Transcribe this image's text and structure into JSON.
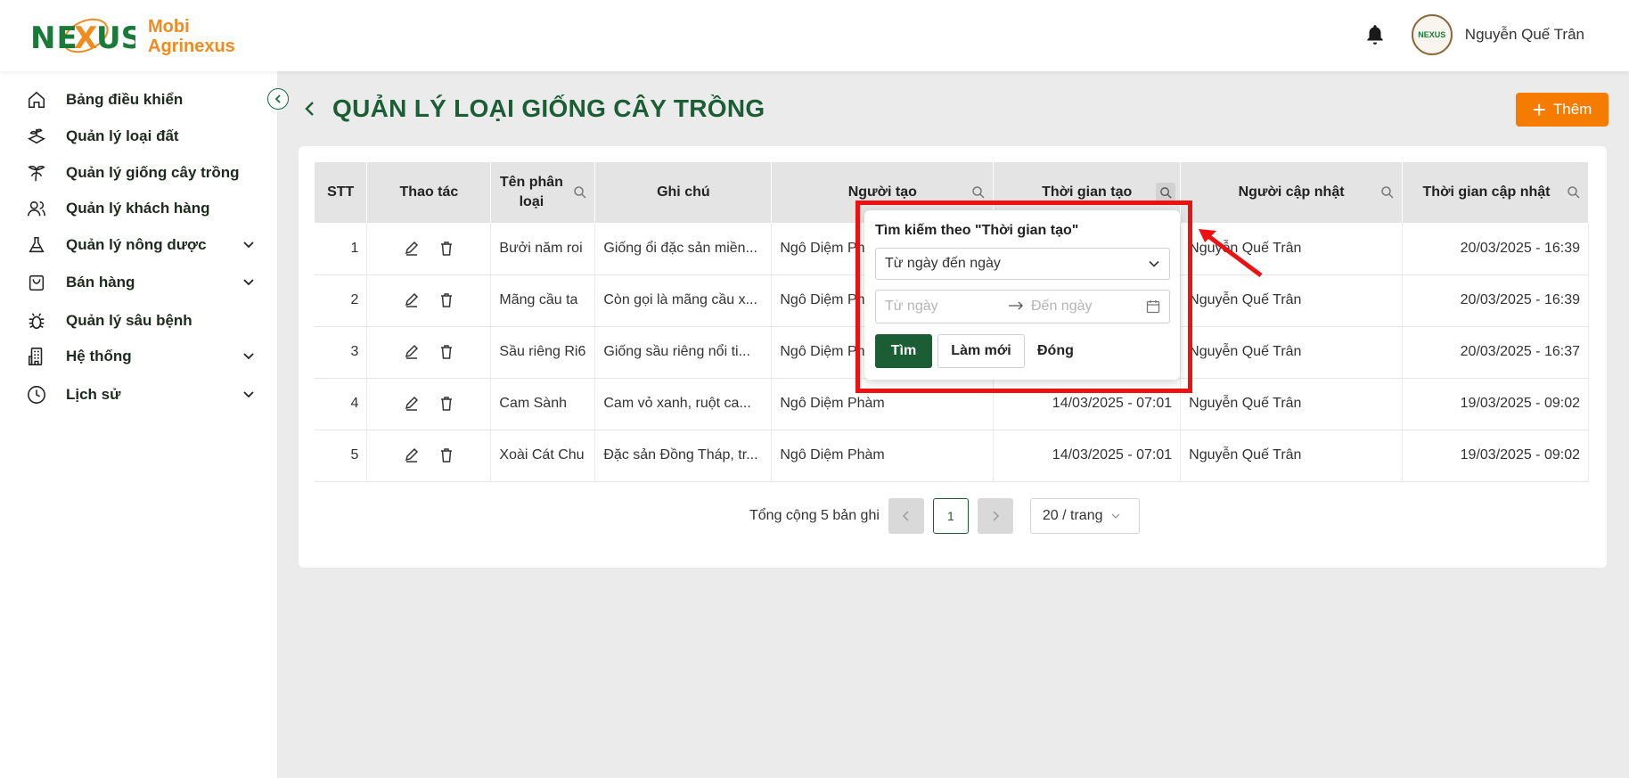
{
  "brand": {
    "line1": "Mobi",
    "line2": "Agrinexus",
    "mark": "NEXUS",
    "avatar_text": "NEXUS"
  },
  "header": {
    "user_name": "Nguyễn Quế Trân"
  },
  "sidebar": {
    "items": [
      {
        "label": "Bảng điều khiển",
        "icon": "home-icon",
        "expandable": false
      },
      {
        "label": "Quản lý loại đất",
        "icon": "soil-icon",
        "expandable": false
      },
      {
        "label": "Quản lý giống cây trồng",
        "icon": "plant-icon",
        "expandable": false
      },
      {
        "label": "Quản lý khách hàng",
        "icon": "users-icon",
        "expandable": false
      },
      {
        "label": "Quản lý nông dược",
        "icon": "flask-icon",
        "expandable": true
      },
      {
        "label": "Bán hàng",
        "icon": "shopping-bag-icon",
        "expandable": true
      },
      {
        "label": "Quản lý sâu bệnh",
        "icon": "bug-icon",
        "expandable": false
      },
      {
        "label": "Hệ thống",
        "icon": "building-icon",
        "expandable": true
      },
      {
        "label": "Lịch sử",
        "icon": "clock-icon",
        "expandable": true
      }
    ]
  },
  "page": {
    "title": "QUẢN LÝ LOẠI GIỐNG CÂY TRỒNG",
    "add_label": "Thêm"
  },
  "table": {
    "headers": {
      "stt": "STT",
      "actions": "Thao tác",
      "name": "Tên phân loại",
      "note": "Ghi chú",
      "creator": "Người tạo",
      "created_at": "Thời gian tạo",
      "updater": "Người cập nhật",
      "updated_at": "Thời gian cập nhật"
    },
    "rows": [
      {
        "stt": "1",
        "name": "Bưởi năm roi",
        "note": "Giống ổi đặc sản miền...",
        "creator": "Ngô Diệm Ph",
        "created_at": "",
        "updater": "Nguyễn Quế Trân",
        "updated_at": "20/03/2025 - 16:39"
      },
      {
        "stt": "2",
        "name": "Mãng cầu ta",
        "note": "Còn gọi là mãng cầu x...",
        "creator": "Ngô Diệm Ph",
        "created_at": "",
        "updater": "Nguyễn Quế Trân",
        "updated_at": "20/03/2025 - 16:39"
      },
      {
        "stt": "3",
        "name": "Sầu riêng Ri6",
        "note": "Giống sầu riêng nổi ti...",
        "creator": "Ngô Diệm Ph",
        "created_at": "",
        "updater": "Nguyễn Quế Trân",
        "updated_at": "20/03/2025 - 16:37"
      },
      {
        "stt": "4",
        "name": "Cam Sành",
        "note": "Cam vỏ xanh, ruột ca...",
        "creator": "Ngô Diệm Phàm",
        "created_at": "14/03/2025 - 07:01",
        "updater": "Nguyễn Quế Trân",
        "updated_at": "19/03/2025 - 09:02"
      },
      {
        "stt": "5",
        "name": "Xoài Cát Chu",
        "note": "Đặc sản Đồng Tháp, tr...",
        "creator": "Ngô Diệm Phàm",
        "created_at": "14/03/2025 - 07:01",
        "updater": "Nguyễn Quế Trân",
        "updated_at": "19/03/2025 - 09:02"
      }
    ]
  },
  "pagination": {
    "total_text": "Tổng cộng 5 bản ghi",
    "current_page": "1",
    "page_size": "20 / trang"
  },
  "filter_popup": {
    "title": "Tìm kiếm theo \"Thời gian tạo\"",
    "mode_value": "Từ ngày đến ngày",
    "from_placeholder": "Từ ngày",
    "to_placeholder": "Đến ngày",
    "search_label": "Tìm",
    "reset_label": "Làm mới",
    "close_label": "Đóng"
  },
  "colors": {
    "brand_green": "#1b5e35",
    "accent_orange": "#f57c00",
    "highlight_red": "#ee1111"
  }
}
